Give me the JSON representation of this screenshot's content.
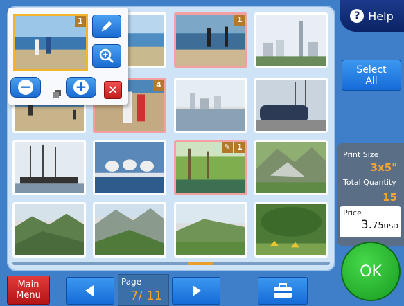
{
  "header": {
    "help_label": "Help",
    "help_glyph": "?"
  },
  "grid": {
    "thumbnails": [
      {
        "scene": "beach-kids",
        "quantity": "",
        "selected": false
      },
      {
        "scene": "beach-sea",
        "quantity": "",
        "selected": false
      },
      {
        "scene": "beach-silhouettes",
        "quantity": "1",
        "selected": true
      },
      {
        "scene": "city-skyline-tower",
        "quantity": "",
        "selected": false
      },
      {
        "scene": "beach-sand",
        "quantity": "",
        "selected": false
      },
      {
        "scene": "beach-kids-close",
        "quantity": "4",
        "selected": true
      },
      {
        "scene": "harbor-skyline",
        "quantity": "",
        "selected": false
      },
      {
        "scene": "vintage-car-ship",
        "quantity": "",
        "selected": false
      },
      {
        "scene": "tall-ship",
        "quantity": "",
        "selected": false
      },
      {
        "scene": "seagulls-rail",
        "quantity": "",
        "selected": false
      },
      {
        "scene": "forest-pond",
        "quantity": "1",
        "selected": true,
        "edited": true
      },
      {
        "scene": "mountain-valley",
        "quantity": "",
        "selected": false
      },
      {
        "scene": "green-mountains",
        "quantity": "",
        "selected": false
      },
      {
        "scene": "rocky-peaks",
        "quantity": "",
        "selected": false
      },
      {
        "scene": "hill-meadow",
        "quantity": "",
        "selected": false
      },
      {
        "scene": "camp-tents",
        "quantity": "",
        "selected": false
      }
    ],
    "scroll_position": 0.55
  },
  "popup": {
    "quantity": "1",
    "edit_icon": "pencil-icon",
    "zoom_icon": "zoom-in-icon",
    "minus_glyph": "−",
    "plus_glyph": "+",
    "copy_icon": "copy-icon",
    "close_glyph": "✕"
  },
  "sidebar": {
    "select_all_line1": "Select",
    "select_all_line2": "All",
    "print_size_label": "Print Size",
    "print_size_value": "3x5\"",
    "total_quantity_label": "Total Quantity",
    "total_quantity_value": "15",
    "price_label": "Price",
    "price_main": "3.",
    "price_cents": "75",
    "price_currency": "USD",
    "ok_label": "OK"
  },
  "footer": {
    "main_menu_line1": "Main",
    "main_menu_line2": "Menu",
    "prev_icon": "left-arrow-icon",
    "next_icon": "right-arrow-icon",
    "page_label": "Page",
    "page_value": "7/ 11",
    "toolbox_icon": "toolbox-icon"
  },
  "colors": {
    "background": "#3f7ec9",
    "accent_orange": "#f3a531",
    "button_blue": "#1b6bd2",
    "ok_green": "#169a21",
    "main_menu_red": "#b31515"
  }
}
